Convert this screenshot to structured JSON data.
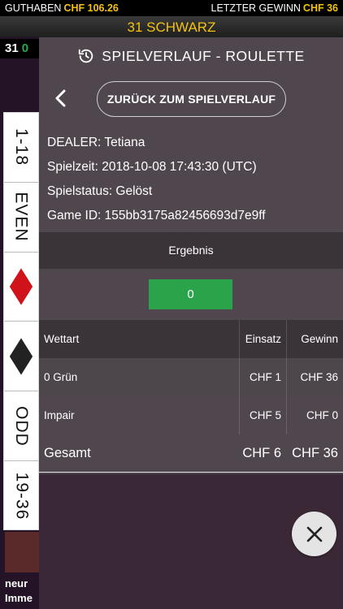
{
  "topbar": {
    "balance_label": "GUTHABEN",
    "balance_value": "CHF 106.26",
    "last_win_label": "LETZTER GEWINN",
    "last_win_value": "CHF 36"
  },
  "banner": {
    "text": "31 SCHWARZ"
  },
  "background": {
    "recent_number": "31",
    "recent_zero": "0",
    "side_bets": [
      "1-18",
      "EVEN",
      "red-diamond",
      "black-diamond",
      "ODD",
      "19-36"
    ],
    "ticker": [
      {
        "user": "neur",
        "text": ""
      },
      {
        "user": "Imme",
        "text": ""
      }
    ]
  },
  "panel": {
    "title": "SPIELVERLAUF - ROULETTE",
    "back_button": "ZURÜCK ZUM SPIELVERLAUF",
    "dealer": "DEALER: Tetiana",
    "playtime": "Spielzeit: 2018-10-08 17:43:30 (UTC)",
    "status": "Spielstatus: Gelöst",
    "game_id": "Game ID: 155bb3175a82456693d7e9ff",
    "result_label": "Ergebnis",
    "result_value": "0",
    "table": {
      "headers": [
        "Wettart",
        "Einsatz",
        "Gewinn"
      ],
      "rows": [
        {
          "type": "0 Grün",
          "stake": "CHF 1",
          "win": "CHF 36"
        },
        {
          "type": "Impair",
          "stake": "CHF 5",
          "win": "CHF 0"
        }
      ],
      "total": {
        "label": "Gesamt",
        "stake": "CHF 6",
        "win": "CHF 36"
      }
    }
  },
  "colors": {
    "accent": "#f4c20d",
    "result_green": "#2aa34a",
    "red": "#d0121b"
  }
}
